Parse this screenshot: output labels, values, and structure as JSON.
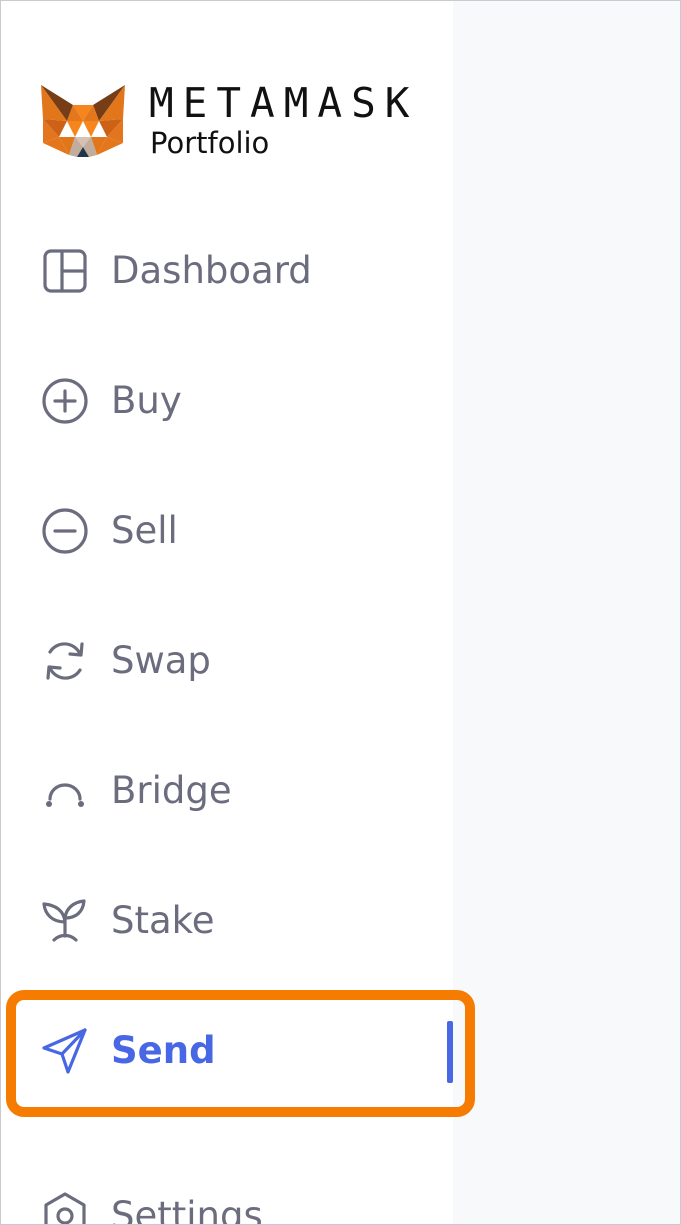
{
  "brand": {
    "wordmark": "METAMASK",
    "product": "Portfolio"
  },
  "nav": {
    "items": [
      {
        "label": "Dashboard",
        "icon": "dashboard-icon"
      },
      {
        "label": "Buy",
        "icon": "plus-circle-icon"
      },
      {
        "label": "Sell",
        "icon": "minus-circle-icon"
      },
      {
        "label": "Swap",
        "icon": "swap-arrows-icon"
      },
      {
        "label": "Bridge",
        "icon": "bridge-arc-icon"
      },
      {
        "label": "Stake",
        "icon": "sprout-icon"
      },
      {
        "label": "Send",
        "icon": "send-plane-icon",
        "active": true
      },
      {
        "label": "Settings",
        "icon": "settings-icon"
      }
    ]
  },
  "colors": {
    "accent": "#4767e4",
    "nav_text": "#6b6c7d",
    "highlight": "#f57c00",
    "fox_orange": "#e2761b"
  }
}
